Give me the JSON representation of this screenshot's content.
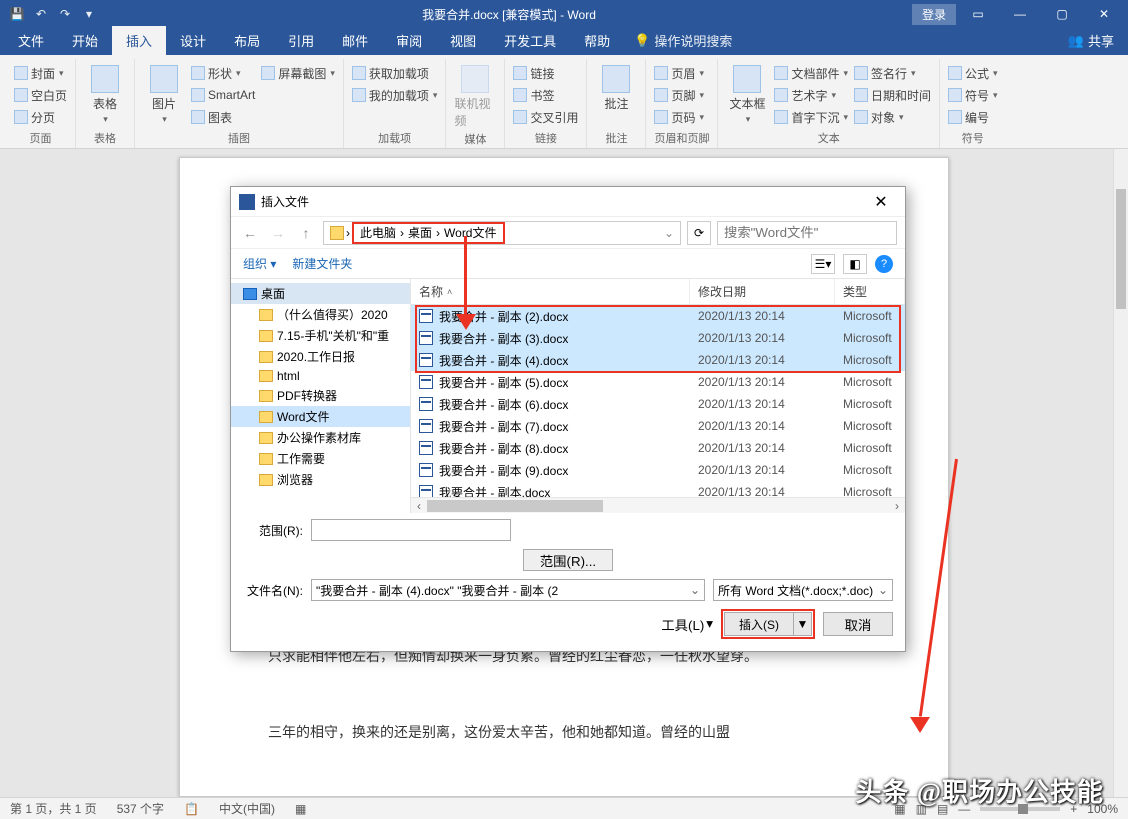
{
  "titlebar": {
    "title": "我要合并.docx [兼容模式] - Word",
    "login": "登录"
  },
  "tabs": {
    "file": "文件",
    "home": "开始",
    "insert": "插入",
    "design": "设计",
    "layout": "布局",
    "references": "引用",
    "mail": "邮件",
    "review": "审阅",
    "view": "视图",
    "dev": "开发工具",
    "help": "帮助",
    "tellme": "操作说明搜索",
    "share": "共享"
  },
  "ribbon": {
    "pages": {
      "label": "页面",
      "cover": "封面",
      "blank": "空白页",
      "break": "分页"
    },
    "tables": {
      "label": "表格",
      "table": "表格"
    },
    "illus": {
      "label": "插图",
      "pic": "图片",
      "shapes": "形状",
      "smartart": "SmartArt",
      "screenshot": "屏幕截图",
      "chart": "图表"
    },
    "addins": {
      "label": "加载项",
      "get": "获取加载项",
      "my": "我的加载项"
    },
    "media": {
      "label": "媒体",
      "video": "联机视频"
    },
    "links": {
      "label": "链接",
      "link": "链接",
      "bookmark": "书签",
      "xref": "交叉引用"
    },
    "comments": {
      "label": "批注",
      "comment": "批注"
    },
    "hf": {
      "label": "页眉和页脚",
      "header": "页眉",
      "footer": "页脚",
      "pagenum": "页码"
    },
    "text": {
      "label": "文本",
      "textbox": "文本框",
      "parts": "文档部件",
      "wordart": "艺术字",
      "dropcap": "首字下沉",
      "sig": "签名行",
      "datetime": "日期和时间",
      "object": "对象"
    },
    "symbols": {
      "label": "符号",
      "equation": "公式",
      "symbol": "符号",
      "number": "编号"
    }
  },
  "doc": {
    "line1": "只求能相伴他左右，但痴情却换来一身负累。曾经的红尘眷恋，一任秋水望穿。",
    "line2": "三年的相守，换来的还是别离，这份爱太辛苦，他和她都知道。曾经的山盟"
  },
  "dialog": {
    "title": "插入文件",
    "bc1": "此电脑",
    "bc2": "桌面",
    "bc3": "Word文件",
    "search_ph": "搜索\"Word文件\"",
    "organize": "组织",
    "newfolder": "新建文件夹",
    "cols": {
      "name": "名称",
      "date": "修改日期",
      "type": "类型"
    },
    "tree": [
      {
        "n": "桌面",
        "lv": 0
      },
      {
        "n": "（什么值得买）2020",
        "lv": 1
      },
      {
        "n": "7.15-手机\"关机\"和\"重",
        "lv": 1
      },
      {
        "n": "2020.工作日报",
        "lv": 1
      },
      {
        "n": "html",
        "lv": 1
      },
      {
        "n": "PDF转换器",
        "lv": 1
      },
      {
        "n": "Word文件",
        "lv": 1,
        "sel": true
      },
      {
        "n": "办公操作素材库",
        "lv": 1
      },
      {
        "n": "工作需要",
        "lv": 1
      },
      {
        "n": "浏览器",
        "lv": 1
      }
    ],
    "files": [
      {
        "n": "我要合并 - 副本 (2).docx",
        "d": "2020/1/13 20:14",
        "t": "Microsoft",
        "sel": true
      },
      {
        "n": "我要合并 - 副本 (3).docx",
        "d": "2020/1/13 20:14",
        "t": "Microsoft",
        "sel": true
      },
      {
        "n": "我要合并 - 副本 (4).docx",
        "d": "2020/1/13 20:14",
        "t": "Microsoft",
        "sel": true
      },
      {
        "n": "我要合并 - 副本 (5).docx",
        "d": "2020/1/13 20:14",
        "t": "Microsoft"
      },
      {
        "n": "我要合并 - 副本 (6).docx",
        "d": "2020/1/13 20:14",
        "t": "Microsoft"
      },
      {
        "n": "我要合并 - 副本 (7).docx",
        "d": "2020/1/13 20:14",
        "t": "Microsoft"
      },
      {
        "n": "我要合并 - 副本 (8).docx",
        "d": "2020/1/13 20:14",
        "t": "Microsoft"
      },
      {
        "n": "我要合并 - 副本 (9).docx",
        "d": "2020/1/13 20:14",
        "t": "Microsoft"
      },
      {
        "n": "我要合并 - 副本.docx",
        "d": "2020/1/13 20:14",
        "t": "Microsoft"
      }
    ],
    "range_lbl": "范围(R):",
    "range_btn": "范围(R)...",
    "fname_lbl": "文件名(N):",
    "fname_val": "\"我要合并 - 副本 (4).docx\" \"我要合并 - 副本 (2",
    "filter": "所有 Word 文档(*.docx;*.doc)",
    "tools": "工具(L)",
    "insert": "插入(S)",
    "cancel": "取消"
  },
  "status": {
    "page": "第 1 页，共 1 页",
    "words": "537 个字",
    "lang": "中文(中国)",
    "zoom": "100%"
  },
  "watermark": "头条 @职场办公技能"
}
